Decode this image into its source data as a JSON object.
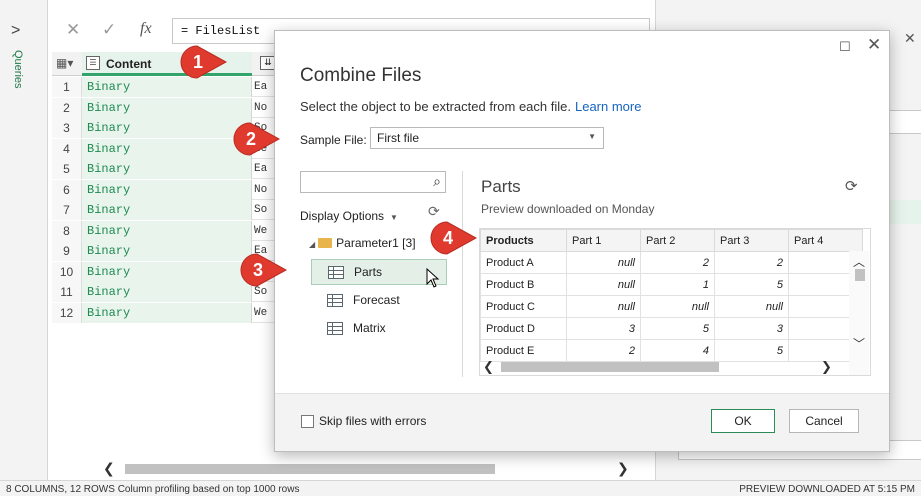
{
  "query_pane": {
    "label": "Queries",
    "chevron": ">"
  },
  "formula_bar": {
    "cancel_glyph": "✕",
    "confirm_glyph": "✓",
    "fx_glyph": "fx",
    "formula": "= FilesList"
  },
  "grid": {
    "content_column": "Content",
    "rows": [
      {
        "num": "1",
        "content": "Binary",
        "next": "Ea"
      },
      {
        "num": "2",
        "content": "Binary",
        "next": "No"
      },
      {
        "num": "3",
        "content": "Binary",
        "next": "So"
      },
      {
        "num": "4",
        "content": "Binary",
        "next": "We"
      },
      {
        "num": "5",
        "content": "Binary",
        "next": "Ea"
      },
      {
        "num": "6",
        "content": "Binary",
        "next": "No"
      },
      {
        "num": "7",
        "content": "Binary",
        "next": "So"
      },
      {
        "num": "8",
        "content": "Binary",
        "next": "We"
      },
      {
        "num": "9",
        "content": "Binary",
        "next": "Ea"
      },
      {
        "num": "10",
        "content": "Binary",
        "next": "No"
      },
      {
        "num": "11",
        "content": "Binary",
        "next": "So"
      },
      {
        "num": "12",
        "content": "Binary",
        "next": "We"
      }
    ]
  },
  "status_bar": {
    "left": "8 COLUMNS, 12 ROWS    Column profiling based on top 1000 rows",
    "right": "PREVIEW DOWNLOADED AT 5:15 PM"
  },
  "dialog": {
    "title": "Combine Files",
    "description": "Select the object to be extracted from each file.",
    "learn_more": "Learn more",
    "sample_file_label": "Sample File:",
    "sample_file_value": "First file",
    "display_options": "Display Options",
    "tree": {
      "root": "Parameter1 [3]",
      "items": [
        "Parts",
        "Forecast",
        "Matrix"
      ]
    },
    "preview": {
      "title": "Parts",
      "subtitle": "Preview downloaded on Monday",
      "columns": [
        "Products",
        "Part 1",
        "Part 2",
        "Part 3",
        "Part 4"
      ],
      "rows": [
        [
          "Product A",
          "null",
          "2",
          "2",
          "n"
        ],
        [
          "Product B",
          "null",
          "1",
          "5",
          ""
        ],
        [
          "Product C",
          "null",
          "null",
          "null",
          ""
        ],
        [
          "Product D",
          "3",
          "5",
          "3",
          ""
        ],
        [
          "Product E",
          "2",
          "4",
          "5",
          "n"
        ]
      ]
    },
    "skip_label": "Skip files with errors",
    "ok_label": "OK",
    "cancel_label": "Cancel"
  },
  "markers": [
    "1",
    "2",
    "3",
    "4"
  ],
  "colors": {
    "marker_red": "#e03a2f",
    "accent_green": "#33a56b",
    "link_blue": "#1565c0"
  }
}
